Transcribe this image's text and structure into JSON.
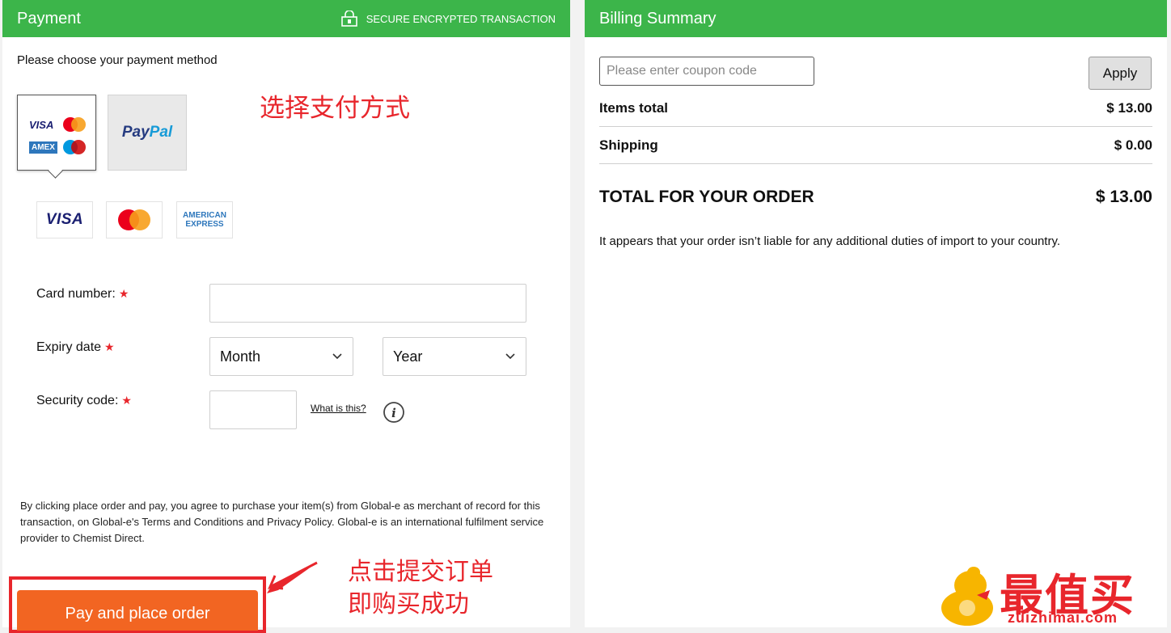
{
  "payment": {
    "title": "Payment",
    "secure_text": "SECURE ENCRYPTED TRANSACTION",
    "choose_text": "Please choose your payment method",
    "methods": {
      "card_label_visa": "VISA",
      "card_label_amex": "AMEX",
      "paypal_part1": "Pay",
      "paypal_part2": "Pal"
    },
    "brands": {
      "visa": "VISA",
      "amex_line1": "AMERICAN",
      "amex_line2": "EXPRESS"
    },
    "card_number_label": "Card number:",
    "expiry_label": "Expiry date",
    "month_value": "Month",
    "year_value": "Year",
    "security_label": "Security code:",
    "required_mark": "★",
    "what_is_this": "What is this?",
    "legal_text": "By clicking place order and pay, you agree to purchase your item(s) from Global-e as merchant of record for this transaction, on Global-e's Terms and Conditions and Privacy Policy. Global-e is an international fulfilment service provider to Chemist Direct.",
    "pay_button": "Pay and place order"
  },
  "annotations": {
    "choose_method_cn": "选择支付方式",
    "submit_line1_cn": "点击提交订单",
    "submit_line2_cn": "即购买成功"
  },
  "billing": {
    "title": "Billing Summary",
    "coupon_placeholder": "Please enter coupon code",
    "apply_button": "Apply",
    "items_total_label": "Items total",
    "items_total_value": "$ 13.00",
    "shipping_label": "Shipping",
    "shipping_value": "$ 0.00",
    "total_label": "TOTAL FOR YOUR ORDER",
    "total_value": "$ 13.00",
    "duties_text": "It appears that your order isn’t liable for any additional duties of import to your country."
  },
  "watermark": {
    "main": "最值买",
    "sub": "zuizhimai.com"
  },
  "colors": {
    "header_green": "#3cb54a",
    "pay_orange": "#f26522",
    "annotation_red": "#e8262c"
  }
}
